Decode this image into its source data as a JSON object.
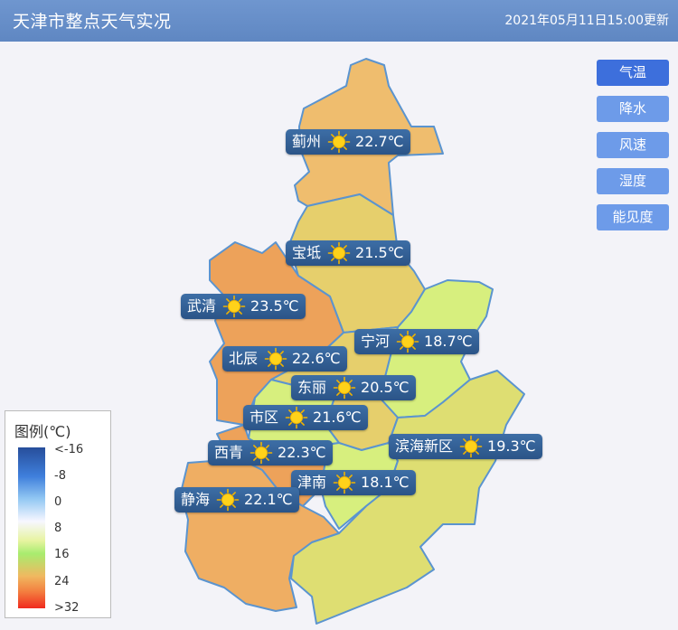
{
  "header": {
    "title": "天津市整点天气实况",
    "updated": "2021年05月11日15:00更新"
  },
  "tabs": [
    {
      "label": "气温",
      "active": true
    },
    {
      "label": "降水",
      "active": false
    },
    {
      "label": "风速",
      "active": false
    },
    {
      "label": "湿度",
      "active": false
    },
    {
      "label": "能见度",
      "active": false
    }
  ],
  "stations": [
    {
      "name": "蓟州",
      "temp": "22.7℃",
      "weather": "sunny"
    },
    {
      "name": "宝坻",
      "temp": "21.5℃",
      "weather": "sunny"
    },
    {
      "name": "武清",
      "temp": "23.5℃",
      "weather": "sunny"
    },
    {
      "name": "宁河",
      "temp": "18.7℃",
      "weather": "sunny"
    },
    {
      "name": "北辰",
      "temp": "22.6℃",
      "weather": "sunny"
    },
    {
      "name": "东丽",
      "temp": "20.5℃",
      "weather": "sunny"
    },
    {
      "name": "市区",
      "temp": "21.6℃",
      "weather": "sunny"
    },
    {
      "name": "滨海新区",
      "temp": "19.3℃",
      "weather": "sunny"
    },
    {
      "name": "西青",
      "temp": "22.3℃",
      "weather": "sunny"
    },
    {
      "name": "津南",
      "temp": "18.1℃",
      "weather": "sunny"
    },
    {
      "name": "静海",
      "temp": "22.1℃",
      "weather": "sunny"
    }
  ],
  "legend": {
    "title": "图例(℃)",
    "ticks": [
      "<-16",
      "-8",
      "0",
      "8",
      "16",
      "24",
      ">32"
    ]
  },
  "colors": {
    "header": "#6f96cf",
    "tab": "#6d9be9",
    "tab_active": "#3d6fdc",
    "label_bg": "#2f5a8e",
    "border": "#5b94cf",
    "region_orange": "#efbd6e",
    "region_deep_orange": "#eda25a",
    "region_yellow": "#e6cf6c",
    "region_green": "#d7ef7e",
    "region_yellow_green": "#dede72"
  }
}
